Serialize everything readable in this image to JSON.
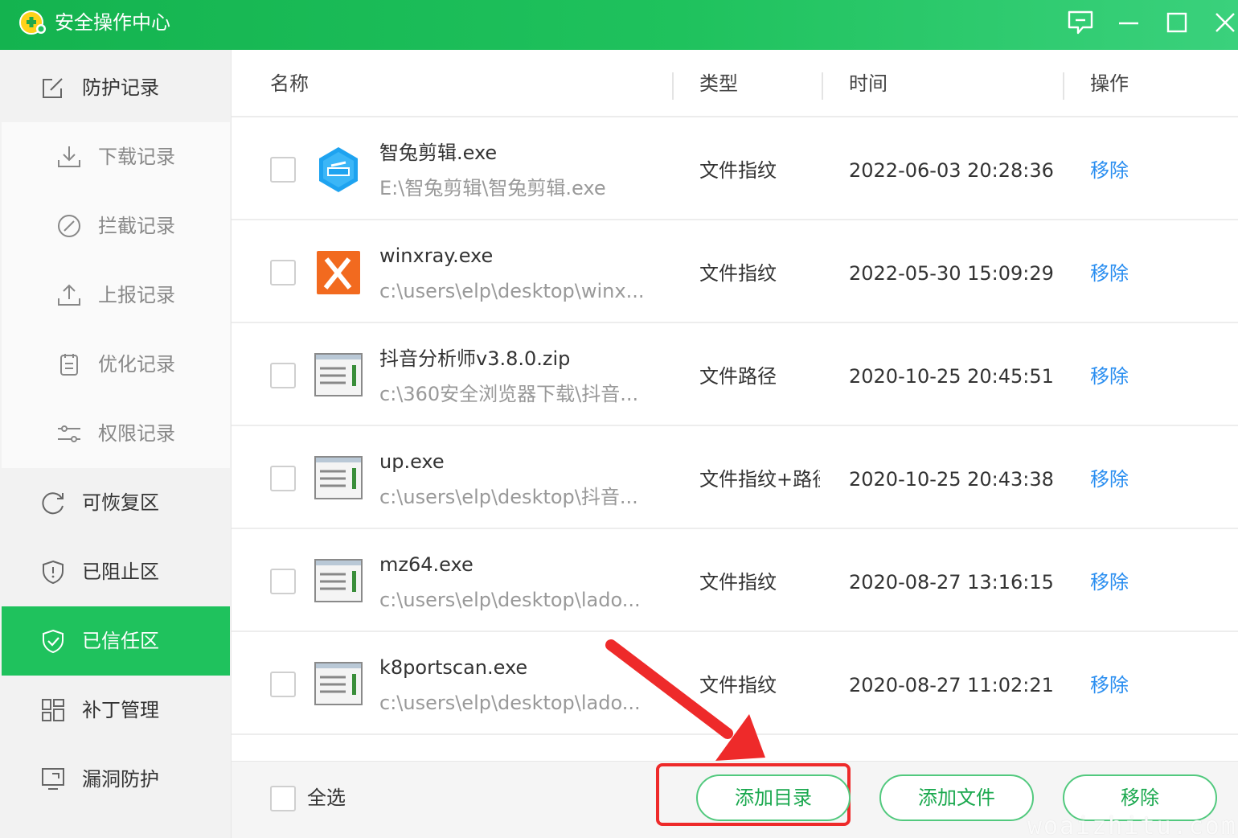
{
  "window": {
    "title": "安全操作中心"
  },
  "sidebar": {
    "items": [
      {
        "label": "防护记录",
        "icon": "edit-icon"
      },
      {
        "label": "下载记录",
        "icon": "download-icon"
      },
      {
        "label": "拦截记录",
        "icon": "block-icon"
      },
      {
        "label": "上报记录",
        "icon": "upload-icon"
      },
      {
        "label": "优化记录",
        "icon": "notepad-icon"
      },
      {
        "label": "权限记录",
        "icon": "sliders-icon"
      },
      {
        "label": "可恢复区",
        "icon": "refresh-icon"
      },
      {
        "label": "已阻止区",
        "icon": "shield-alert-icon"
      },
      {
        "label": "已信任区",
        "icon": "shield-check-icon",
        "active": true
      },
      {
        "label": "补丁管理",
        "icon": "grid-icon"
      },
      {
        "label": "漏洞防护",
        "icon": "monitor-icon"
      }
    ]
  },
  "table": {
    "headers": {
      "name": "名称",
      "type": "类型",
      "time": "时间",
      "action": "操作"
    },
    "rows": [
      {
        "name": "智兔剪辑.exe",
        "path": "E:\\智兔剪辑\\智兔剪辑.exe",
        "type": "文件指纹",
        "time": "2022-06-03 20:28:36",
        "action": "移除",
        "icon": "app-hexagon-icon"
      },
      {
        "name": "winxray.exe",
        "path": "c:\\users\\elp\\desktop\\winx...",
        "type": "文件指纹",
        "time": "2022-05-30 15:09:29",
        "action": "移除",
        "icon": "app-x-icon"
      },
      {
        "name": "抖音分析师v3.8.0.zip",
        "path": "c:\\360安全浏览器下载\\抖音...",
        "type": "文件路径",
        "time": "2020-10-25 20:45:51",
        "action": "移除",
        "icon": "file-window-icon"
      },
      {
        "name": "up.exe",
        "path": "c:\\users\\elp\\desktop\\抖音...",
        "type": "文件指纹+路径",
        "time": "2020-10-25 20:43:38",
        "action": "移除",
        "icon": "file-window-icon"
      },
      {
        "name": "mz64.exe",
        "path": "c:\\users\\elp\\desktop\\lado...",
        "type": "文件指纹",
        "time": "2020-08-27 13:16:15",
        "action": "移除",
        "icon": "file-window-icon"
      },
      {
        "name": "k8portscan.exe",
        "path": "c:\\users\\elp\\desktop\\lado...",
        "type": "文件指纹",
        "time": "2020-08-27 11:02:21",
        "action": "移除",
        "icon": "file-window-icon"
      }
    ]
  },
  "footer": {
    "select_all": "全选",
    "add_dir": "添加目录",
    "add_file": "添加文件",
    "remove": "移除"
  },
  "watermark": "woaizhitu.com",
  "colors": {
    "brand": "#1fc25d",
    "link": "#2a8ef0",
    "highlight": "#ee2a2a"
  }
}
